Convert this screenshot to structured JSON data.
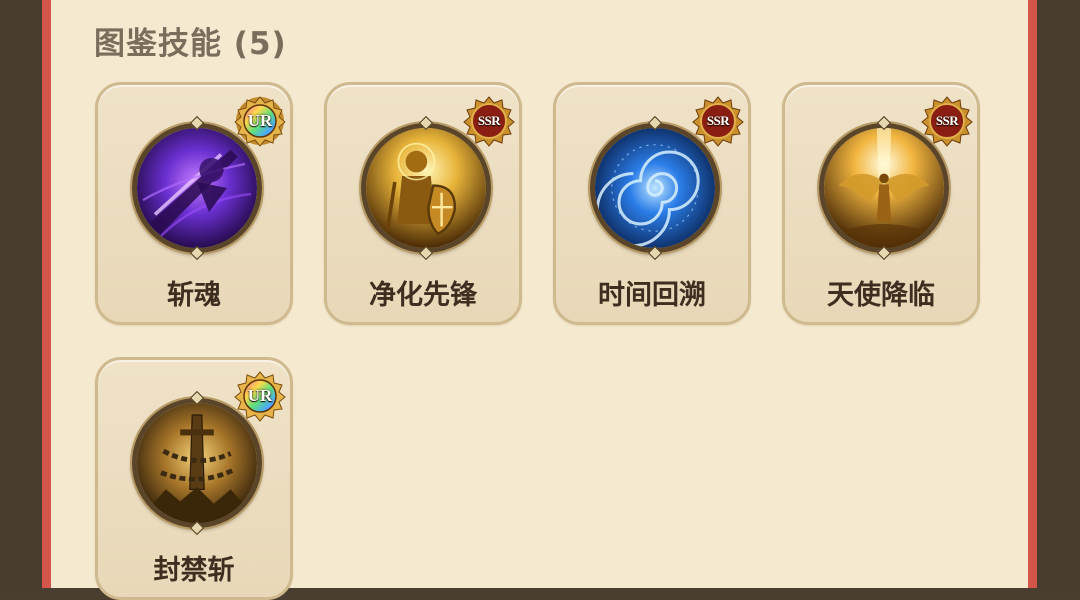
{
  "section": {
    "title": "图鉴技能 (5)"
  },
  "skills": [
    {
      "name": "斩魂",
      "rarity": "UR",
      "icon": "purple-sword-slash-icon",
      "theme": "#6a2fd0"
    },
    {
      "name": "净化先锋",
      "rarity": "SSR",
      "icon": "golden-knight-shield-icon",
      "theme": "#e8b43a"
    },
    {
      "name": "时间回溯",
      "rarity": "SSR",
      "icon": "blue-time-vortex-icon",
      "theme": "#2b7de8"
    },
    {
      "name": "天使降临",
      "rarity": "SSR",
      "icon": "golden-angel-wings-icon",
      "theme": "#f2b640"
    },
    {
      "name": "封禁斩",
      "rarity": "UR",
      "icon": "chained-sword-rock-icon",
      "theme": "#c99a3c"
    }
  ],
  "colors": {
    "panel_bg": "#f5ead0",
    "frame_red": "#d4564b",
    "card_border": "#cfb98f",
    "title_text": "#7b6d5c",
    "name_text": "#3d2e20"
  }
}
